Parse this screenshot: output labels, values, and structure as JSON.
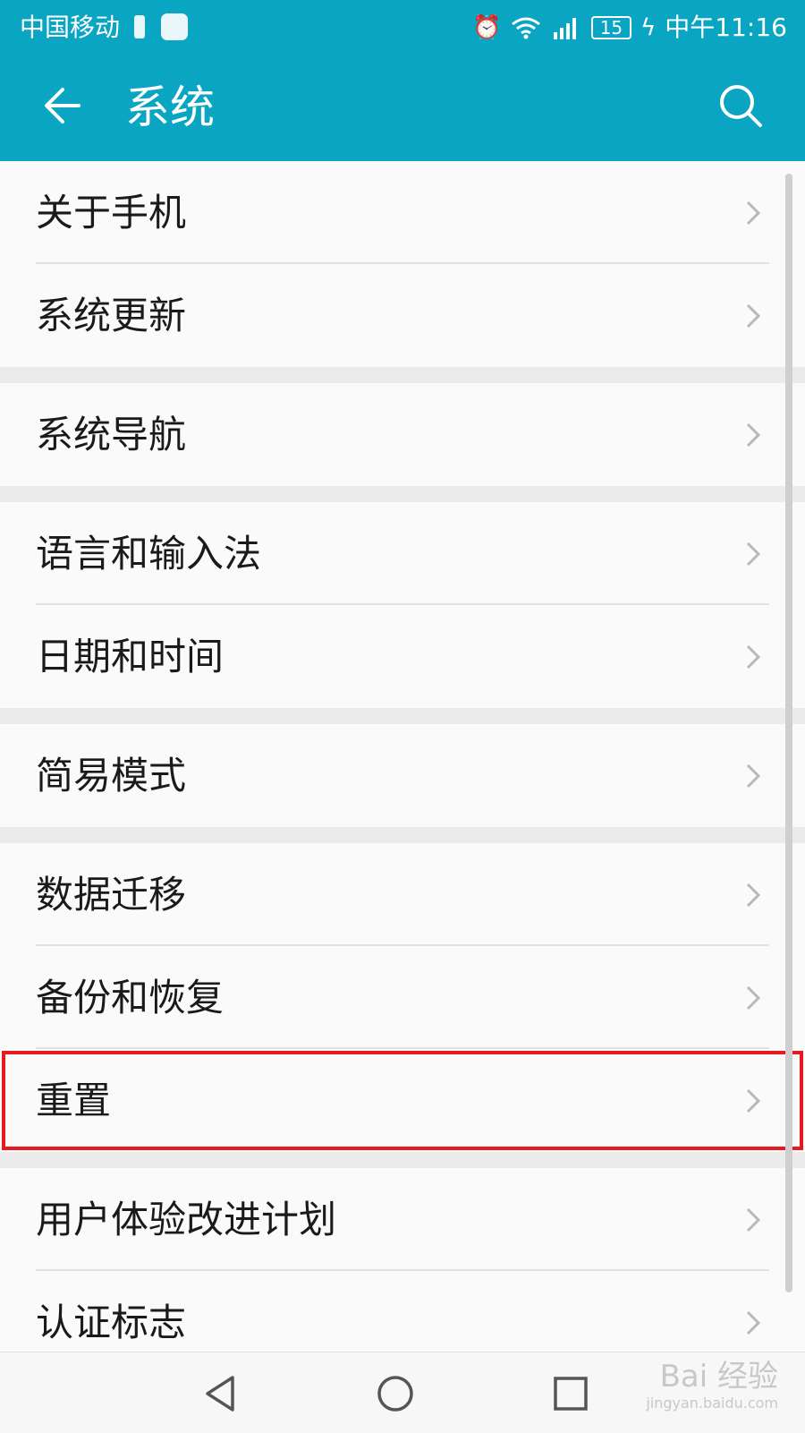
{
  "status_bar": {
    "carrier": "中国移动",
    "battery_level": "15",
    "time": "中午11:16",
    "icons": [
      "battery-saver-icon",
      "video-app-icon",
      "alarm-icon",
      "wifi-icon",
      "4g-signal-icon",
      "charging-icon"
    ]
  },
  "app_bar": {
    "title": "系统",
    "back_icon": "back-arrow-icon",
    "search_icon": "search-icon"
  },
  "groups": [
    {
      "items": [
        {
          "label": "关于手机"
        },
        {
          "label": "系统更新"
        }
      ]
    },
    {
      "items": [
        {
          "label": "系统导航"
        }
      ]
    },
    {
      "items": [
        {
          "label": "语言和输入法"
        },
        {
          "label": "日期和时间"
        }
      ]
    },
    {
      "items": [
        {
          "label": "简易模式"
        }
      ]
    },
    {
      "items": [
        {
          "label": "数据迁移"
        },
        {
          "label": "备份和恢复"
        },
        {
          "label": "重置",
          "highlighted": true
        }
      ]
    },
    {
      "items": [
        {
          "label": "用户体验改进计划"
        },
        {
          "label": "认证标志"
        }
      ]
    }
  ],
  "colors": {
    "accent": "#0aa5c2",
    "highlight_border": "#e8191e",
    "list_background": "#fafafa",
    "group_gap": "#ebebeb"
  },
  "nav_bar": {
    "icons": [
      "back-triangle-icon",
      "home-circle-icon",
      "recents-square-icon"
    ]
  },
  "watermark": {
    "brand": "Bai 经验",
    "url": "jingyan.baidu.com"
  }
}
